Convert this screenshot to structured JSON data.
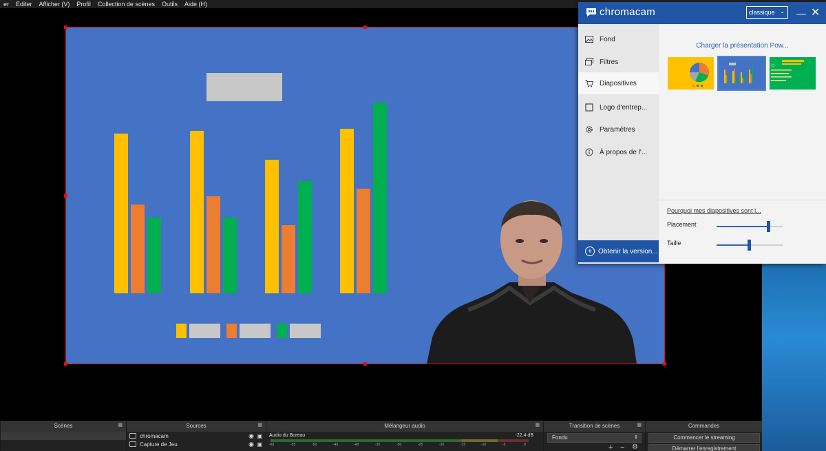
{
  "menubar": {
    "items": [
      "er",
      "Editer",
      "Afficher (V)",
      "Profil",
      "Collection de scènes",
      "Outils",
      "Aide (H)"
    ]
  },
  "slide": {
    "background": "#4472c4",
    "bar_colors": [
      "#ffc000",
      "#ed7d31",
      "#00b050"
    ],
    "bar_groups": [
      [
        0.61,
        0.34,
        0.29
      ],
      [
        0.62,
        0.37,
        0.29
      ],
      [
        0.51,
        0.26,
        0.43
      ],
      [
        0.63,
        0.4,
        0.73
      ]
    ]
  },
  "chromacam": {
    "brand": "chromacam",
    "mode_select": "classique",
    "nav": [
      {
        "label": "Fond",
        "icon": "image-icon"
      },
      {
        "label": "Filtres",
        "icon": "layers-icon"
      },
      {
        "label": "Diapositives",
        "icon": "cart-icon"
      },
      {
        "label": "Logo d'entrep...",
        "icon": "square-icon"
      },
      {
        "label": "Paramètres",
        "icon": "gear-icon"
      },
      {
        "label": "À propos de l'...",
        "icon": "info-icon"
      }
    ],
    "active_nav": "Diapositives",
    "upgrade_label": "Obtenir la version...",
    "load_link": "Charger la présentation Pow...",
    "why_link": "Pourquoi mes diapositives sont i...",
    "placement_label": "Placement",
    "placement_value": 0.78,
    "size_label": "Taille",
    "size_value": 0.49,
    "colors": {
      "brand_blue": "#1f55a4",
      "link_blue": "#2c66b8"
    }
  },
  "docks": {
    "scenes_title": "Scènes",
    "sources_title": "Sources",
    "mixer_title": "Mélangeur audio",
    "transition_title": "Transition de scènes",
    "controls_title": "Commandes",
    "sources": [
      "chromacam",
      "Capture de Jeu"
    ],
    "mixer_track": "Audio du Bureau",
    "mixer_db": "-22.4 dB",
    "mixer_ticks": [
      "-60",
      "-55",
      "-50",
      "-45",
      "-40",
      "-35",
      "-30",
      "-25",
      "-20",
      "-15",
      "-10",
      "-5",
      "0"
    ],
    "transition_value": "Fondu",
    "start_stream": "Commencer le streaming",
    "start_record": "Démarrer l'enregistrement"
  }
}
